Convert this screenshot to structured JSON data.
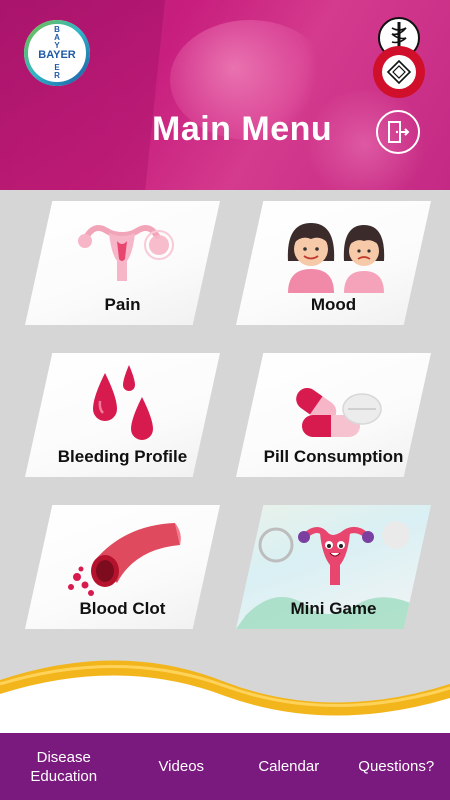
{
  "header": {
    "title": "Main Menu",
    "logo_text": "BAYER",
    "exit_icon": "exit-door-icon"
  },
  "menu": {
    "items": [
      {
        "label": "Pain",
        "icon": "uterus-icon"
      },
      {
        "label": "Mood",
        "icon": "mood-faces-icon"
      },
      {
        "label": "Bleeding Profile",
        "icon": "blood-drops-icon"
      },
      {
        "label": "Pill Consumption",
        "icon": "pills-icon"
      },
      {
        "label": "Blood Clot",
        "icon": "blood-vessel-icon"
      },
      {
        "label": "Mini Game",
        "icon": "game-character-icon"
      }
    ]
  },
  "nav": {
    "items": [
      {
        "label": "Disease Education"
      },
      {
        "label": "Videos"
      },
      {
        "label": "Calendar"
      },
      {
        "label": "Questions?"
      }
    ]
  },
  "colors": {
    "header": "#c81f7e",
    "nav": "#7a1a7f",
    "accent_pink": "#e8466f",
    "wave_gold": "#f2b51c"
  }
}
